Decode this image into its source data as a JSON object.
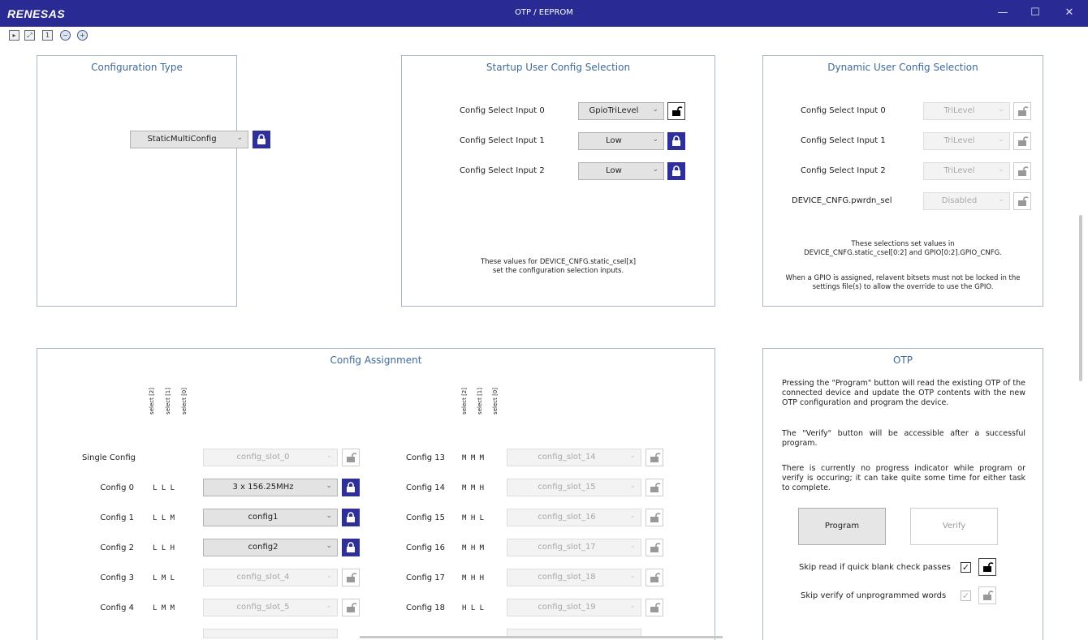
{
  "window": {
    "logo": "RENESAS",
    "title": "OTP / EEPROM",
    "min": "—",
    "max": "☐",
    "close": "✕"
  },
  "toolbar": {
    "icons": [
      "save-file-icon",
      "fit-view-icon",
      "zoom-100-icon",
      "zoom-out-icon",
      "zoom-in-icon"
    ]
  },
  "config_type": {
    "title": "Configuration Type",
    "value": "StaticMultiConfig",
    "locked": true
  },
  "startup": {
    "title": "Startup User Config Selection",
    "rows": [
      {
        "label": "Config Select Input 0",
        "value": "GpioTriLevel",
        "locked": false
      },
      {
        "label": "Config Select Input 1",
        "value": "Low",
        "locked": true
      },
      {
        "label": "Config Select Input 2",
        "value": "Low",
        "locked": true
      }
    ],
    "note_line1": "These values for DEVICE_CNFG.static_csel[x]",
    "note_line2": "set the configuration selection inputs."
  },
  "dynamic": {
    "title": "Dynamic User Config Selection",
    "rows": [
      {
        "label": "Config Select Input 0",
        "value": "TriLevel"
      },
      {
        "label": "Config Select Input 1",
        "value": "TriLevel"
      },
      {
        "label": "Config Select Input 2",
        "value": "TriLevel"
      },
      {
        "label": "DEVICE_CNFG.pwrdn_sel",
        "value": "Disabled"
      }
    ],
    "note1_line1": "These selections set values in",
    "note1_line2": "DEVICE_CNFG.static_csel[0:2] and GPIO[0:2].GPIO_CNFG.",
    "note2_line1": "When a GPIO is assigned, relavent bitsets must not be locked in the",
    "note2_line2": "settings file(s) to allow the override to use the GPIO."
  },
  "assign": {
    "title": "Config Assignment",
    "headers": [
      "select [2]",
      "select [1]",
      "select [0]"
    ],
    "left": [
      {
        "label": "Single Config",
        "sel": "",
        "value": "config_slot_0",
        "locked": false,
        "enabled": false
      },
      {
        "label": "Config 0",
        "sel": "L L L",
        "value": "3 x 156.25MHz",
        "locked": true,
        "enabled": true
      },
      {
        "label": "Config 1",
        "sel": "L L M",
        "value": "config1",
        "locked": true,
        "enabled": true
      },
      {
        "label": "Config 2",
        "sel": "L L H",
        "value": "config2",
        "locked": true,
        "enabled": true
      },
      {
        "label": "Config 3",
        "sel": "L M L",
        "value": "config_slot_4",
        "locked": false,
        "enabled": false
      },
      {
        "label": "Config 4",
        "sel": "L M M",
        "value": "config_slot_5",
        "locked": false,
        "enabled": false
      }
    ],
    "right": [
      {
        "label": "Config 13",
        "sel": "M M M",
        "value": "config_slot_14"
      },
      {
        "label": "Config 14",
        "sel": "M M H",
        "value": "config_slot_15"
      },
      {
        "label": "Config 15",
        "sel": "M H L",
        "value": "config_slot_16"
      },
      {
        "label": "Config 16",
        "sel": "M H M",
        "value": "config_slot_17"
      },
      {
        "label": "Config 17",
        "sel": "M H H",
        "value": "config_slot_18"
      },
      {
        "label": "Config 18",
        "sel": "H L L",
        "value": "config_slot_19"
      }
    ]
  },
  "otp": {
    "title": "OTP",
    "p1": "Pressing the \"Program\" button will read the existing OTP of the connected device and update the OTP contents with the new OTP configuration and program the device.",
    "p2": "The \"Verify\" button will be accessible after a successful program.",
    "p3": "There is currently no progress indicator while program or verify is occuring; it can take quite some time for either task to complete.",
    "program_label": "Program",
    "verify_label": "Verify",
    "skip_read_label": "Skip read if quick blank check passes",
    "skip_verify_label": "Skip verify of unprogrammed words"
  }
}
